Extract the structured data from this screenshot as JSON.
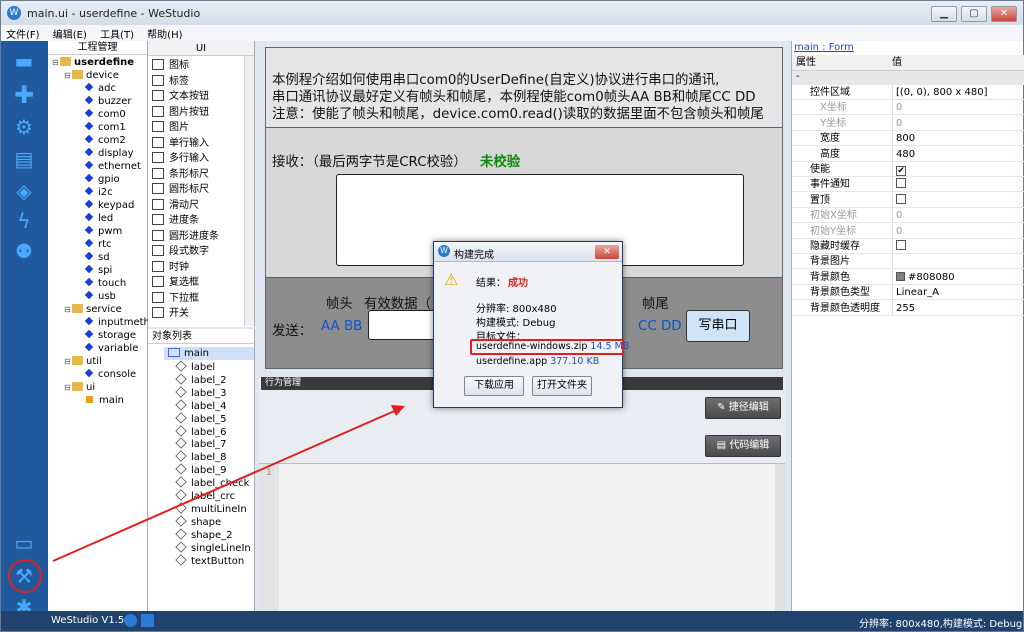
{
  "window": {
    "title": "main.ui - userdefine - WeStudio"
  },
  "menu": [
    "文件(F)",
    "编辑(E)",
    "工具(T)",
    "帮助(H)"
  ],
  "project_tree": {
    "header": "工程管理",
    "root": "userdefine",
    "device_folder": "device",
    "device_items": [
      "adc",
      "buzzer",
      "com0",
      "com1",
      "com2",
      "display",
      "ethernet",
      "gpio",
      "i2c",
      "keypad",
      "led",
      "pwm",
      "rtc",
      "sd",
      "spi",
      "touch",
      "usb"
    ],
    "service_folder": "service",
    "service_items": [
      "inputmethod",
      "storage",
      "variable"
    ],
    "util_folder": "util",
    "util_items": [
      "console"
    ],
    "ui_folder": "ui",
    "ui_items": [
      "main"
    ]
  },
  "palette": {
    "header": "UI",
    "items": [
      "图标",
      "标签",
      "文本按钮",
      "图片按钮",
      "图片",
      "单行输入",
      "多行输入",
      "条形标尺",
      "圆形标尺",
      "滑动尺",
      "进度条",
      "圆形进度条",
      "段式数字",
      "时钟",
      "复选框",
      "下拉框",
      "开关"
    ]
  },
  "object_list": {
    "header": "对象列表",
    "root": "main",
    "items": [
      "label",
      "label_2",
      "label_3",
      "label_4",
      "label_5",
      "label_6",
      "label_7",
      "label_8",
      "label_9",
      "label_check",
      "label_crc",
      "multiLineIn",
      "shape",
      "shape_2",
      "singleLineIn",
      "textButton"
    ]
  },
  "canvas": {
    "intro_lines": [
      "本例程介绍如何使用串口com0的UserDefine(自定义)协议进行串口的通讯,",
      "串口通讯协议最好定义有帧头和帧尾，本例程使能com0帧头AA BB和帧尾CC DD",
      "注意：使能了帧头和帧尾，device.com0.read()读取的数据里面不包含帧头和帧尾"
    ],
    "receive_label": "接收：（最后两字节是CRC校验）",
    "check_status": "未校验",
    "frame_head_label": "帧头",
    "payload_label": "有效数据（",
    "frame_tail_label": "帧尾",
    "send_label": "发送：",
    "head_value": "AA BB",
    "tail_value": "CC DD",
    "write_button": "写串口"
  },
  "behavior": {
    "header": "行为管理",
    "quick_edit": "捷径编辑",
    "code_edit": "代码编辑",
    "line_number": "1"
  },
  "properties": {
    "tab": "main : Form",
    "col_prop": "属性",
    "col_value": "值",
    "rows": [
      {
        "k": "控件区域",
        "v": "[(0, 0), 800 x 480]"
      },
      {
        "k": "X坐标",
        "v": "0"
      },
      {
        "k": "Y坐标",
        "v": "0"
      },
      {
        "k": "宽度",
        "v": "800"
      },
      {
        "k": "高度",
        "v": "480"
      },
      {
        "k": "使能",
        "v": "✔"
      },
      {
        "k": "事件通知",
        "v": ""
      },
      {
        "k": "置顶",
        "v": ""
      },
      {
        "k": "初始X坐标",
        "v": "0"
      },
      {
        "k": "初始Y坐标",
        "v": "0"
      },
      {
        "k": "隐藏时缓存",
        "v": ""
      },
      {
        "k": "背景图片",
        "v": ""
      },
      {
        "k": "背景颜色",
        "v": "#808080"
      },
      {
        "k": "背景颜色类型",
        "v": "Linear_A"
      },
      {
        "k": "背景颜色透明度",
        "v": "255"
      }
    ]
  },
  "dialog": {
    "title": "构建完成",
    "result_label": "结果：",
    "result_value": "成功",
    "resolution": "分辨率: 800x480",
    "build_mode": "构建模式: Debug",
    "target_label": "目标文件：",
    "file1_name": "userdefine-windows.zip",
    "file1_size": "14.5 MB",
    "file2_name": "userdefine.app",
    "file2_size": "377.10 KB",
    "btn_download": "下载应用",
    "btn_open": "打开文件夹"
  },
  "status": {
    "version": "WeStudio V1.5.0",
    "right": "分辨率: 800x480,构建模式: Debug"
  },
  "colors": {
    "accent": "#0a56c9",
    "success": "#e02020",
    "check_green": "#0a8a0a",
    "annotation": "#e02020"
  }
}
